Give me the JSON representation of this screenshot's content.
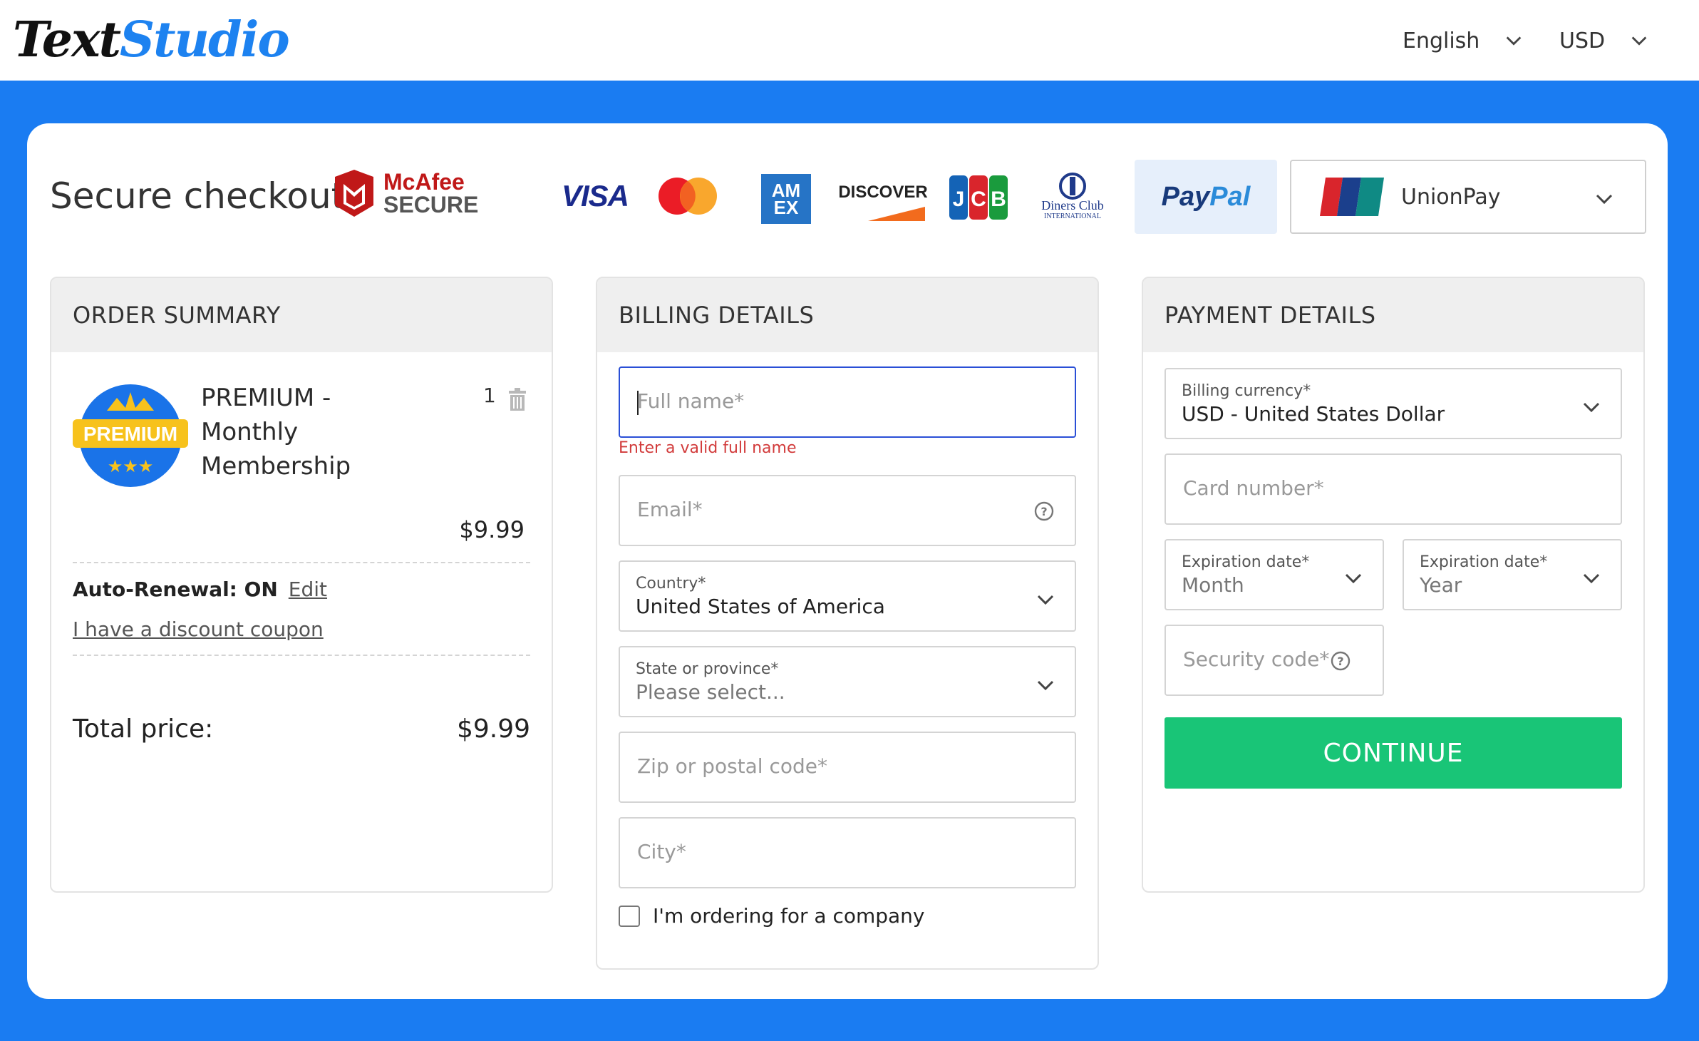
{
  "header": {
    "logo_part1": "Text",
    "logo_part2": "Studio",
    "language": "English",
    "currency": "USD"
  },
  "checkout": {
    "title": "Secure checkout",
    "mcafee_top": "McAfee",
    "mcafee_bottom": "SECURE",
    "payment_methods": {
      "visa": "VISA",
      "amex_top": "AM",
      "amex_bottom": "EX",
      "discover": "DISCOVER",
      "diners_top": "Diners Club",
      "diners_bottom": "INTERNATIONAL",
      "paypal_1": "Pay",
      "paypal_2": "Pal",
      "unionpay": "UnionPay"
    }
  },
  "order_summary": {
    "heading": "ORDER SUMMARY",
    "badge_text": "PREMIUM",
    "product_line1": "PREMIUM -",
    "product_line2": "Monthly",
    "product_line3": "Membership",
    "quantity": "1",
    "price": "$9.99",
    "auto_renewal_label": "Auto-Renewal: ON",
    "edit_link": "Edit",
    "coupon_link": "I have a discount coupon",
    "total_label": "Total price:",
    "total_value": "$9.99"
  },
  "billing": {
    "heading": "BILLING DETAILS",
    "full_name_placeholder": "Full name*",
    "full_name_error": "Enter a valid full name",
    "email_placeholder": "Email*",
    "country_label": "Country*",
    "country_value": "United States of America",
    "state_label": "State or province*",
    "state_value": "Please select...",
    "zip_placeholder": "Zip or postal code*",
    "city_placeholder": "City*",
    "company_checkbox": "I'm ordering for a company"
  },
  "payment": {
    "heading": "PAYMENT DETAILS",
    "currency_label": "Billing currency*",
    "currency_value": "USD - United States Dollar",
    "card_placeholder": "Card number*",
    "exp_month_label": "Expiration date*",
    "exp_month_value": "Month",
    "exp_year_label": "Expiration date*",
    "exp_year_value": "Year",
    "security_placeholder": "Security code*",
    "continue_button": "CONTINUE"
  },
  "colors": {
    "brand_blue": "#1a7cf2",
    "continue_green": "#19c577",
    "error_red": "#d23b3b",
    "focus_blue": "#2a4fd6"
  }
}
